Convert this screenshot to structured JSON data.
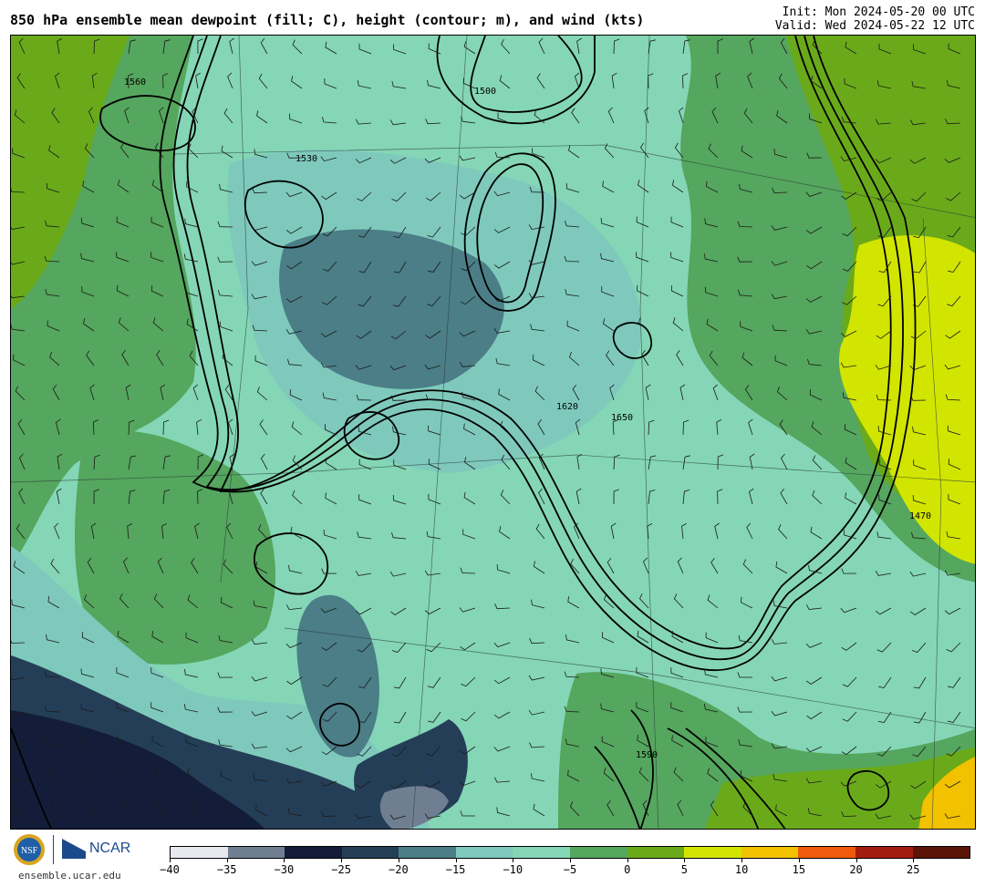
{
  "header": {
    "title": "850 hPa ensemble mean dewpoint (fill; C), height (contour; m), and wind (kts)",
    "init": "Init: Mon 2024-05-20 00 UTC",
    "valid": "Valid: Wed 2024-05-22 12 UTC"
  },
  "footer": {
    "site": "ensemble.ucar.edu",
    "org_text": "NCAR",
    "nsf_text": "NSF"
  },
  "colorbar": {
    "colors": [
      "#e8e8f0",
      "#6f7f91",
      "#131d39",
      "#253e57",
      "#4b7e87",
      "#7ec9bc",
      "#84d6b6",
      "#55a65e",
      "#6aaa1a",
      "#d2e500",
      "#f2c100",
      "#f05a0c",
      "#a31c10",
      "#5b1408"
    ],
    "ticks": [
      "−40",
      "−35",
      "−30",
      "−25",
      "−20",
      "−15",
      "−10",
      "−5",
      "0",
      "5",
      "10",
      "15",
      "20",
      "25"
    ]
  },
  "map": {
    "contour_labels": [
      "1500",
      "1530",
      "1560",
      "1590",
      "1620",
      "1650",
      "1470"
    ]
  }
}
